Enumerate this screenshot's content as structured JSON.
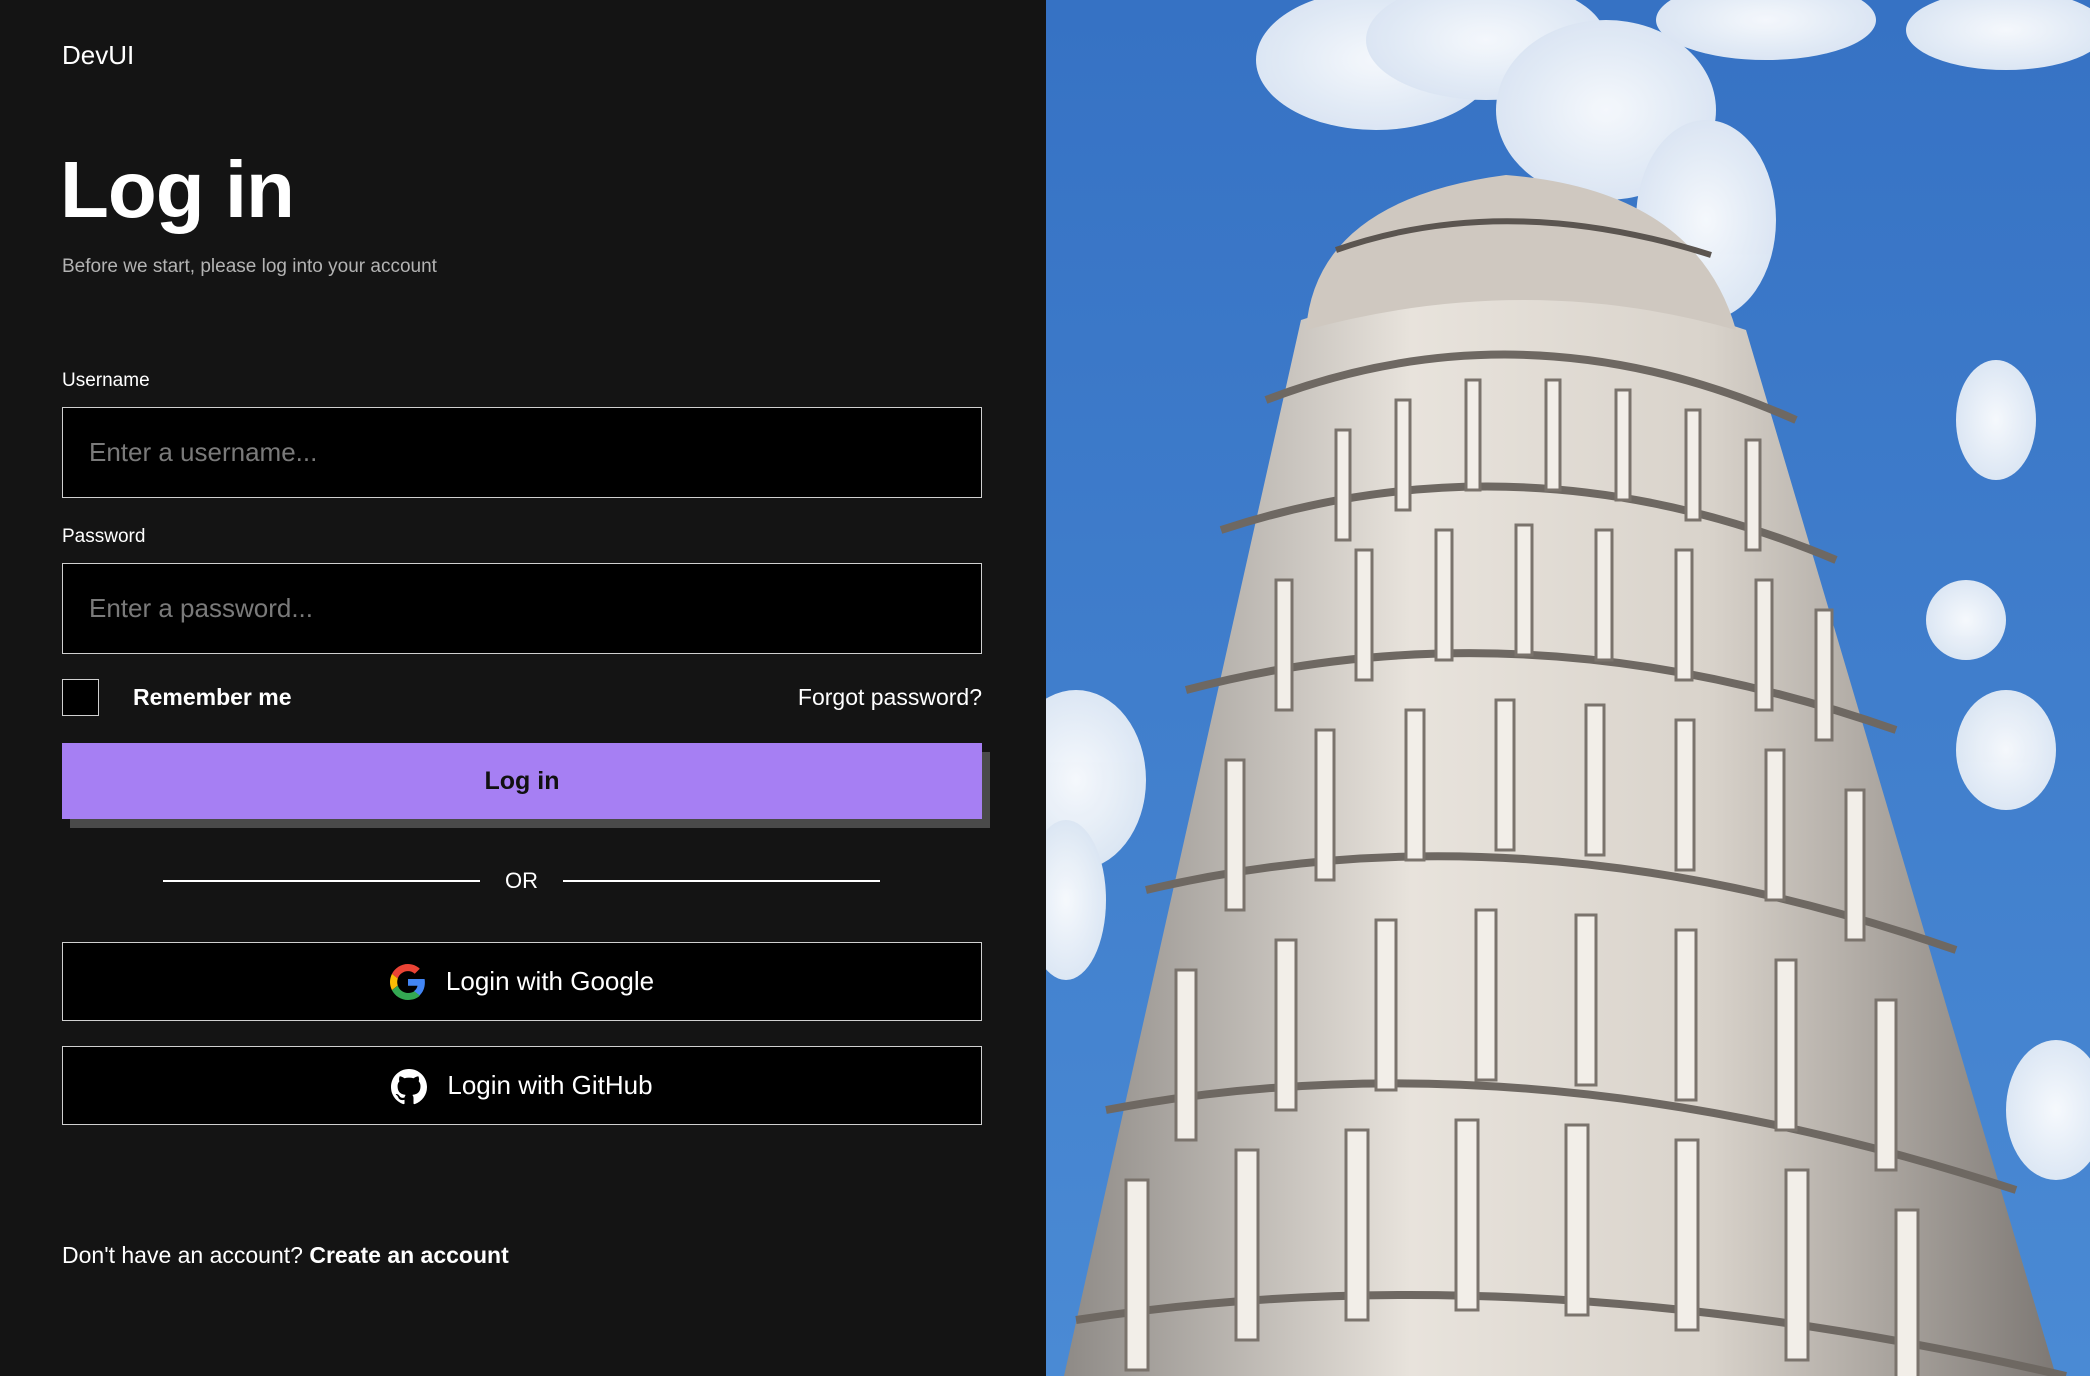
{
  "brand": "DevUI",
  "heading": {
    "title": "Log in",
    "subtitle": "Before we start, please log into your account"
  },
  "form": {
    "username_label": "Username",
    "username_placeholder": "Enter a username...",
    "username_value": "",
    "password_label": "Password",
    "password_placeholder": "Enter a password...",
    "password_value": "",
    "remember_label": "Remember me",
    "remember_checked": false,
    "forgot_label": "Forgot password?",
    "submit_label": "Log in"
  },
  "divider_text": "OR",
  "oauth": {
    "google_label": "Login with Google",
    "google_icon": "google-icon",
    "github_label": "Login with GitHub",
    "github_icon": "github-icon"
  },
  "signup": {
    "prompt": "Don't have an account?",
    "link_label": "Create an account"
  },
  "hero_image": {
    "subject": "leaning-tower-photo"
  },
  "colors": {
    "background": "#141414",
    "accent": "#a67ff3",
    "input_bg": "#000000",
    "sky": "#3f7fcc"
  }
}
